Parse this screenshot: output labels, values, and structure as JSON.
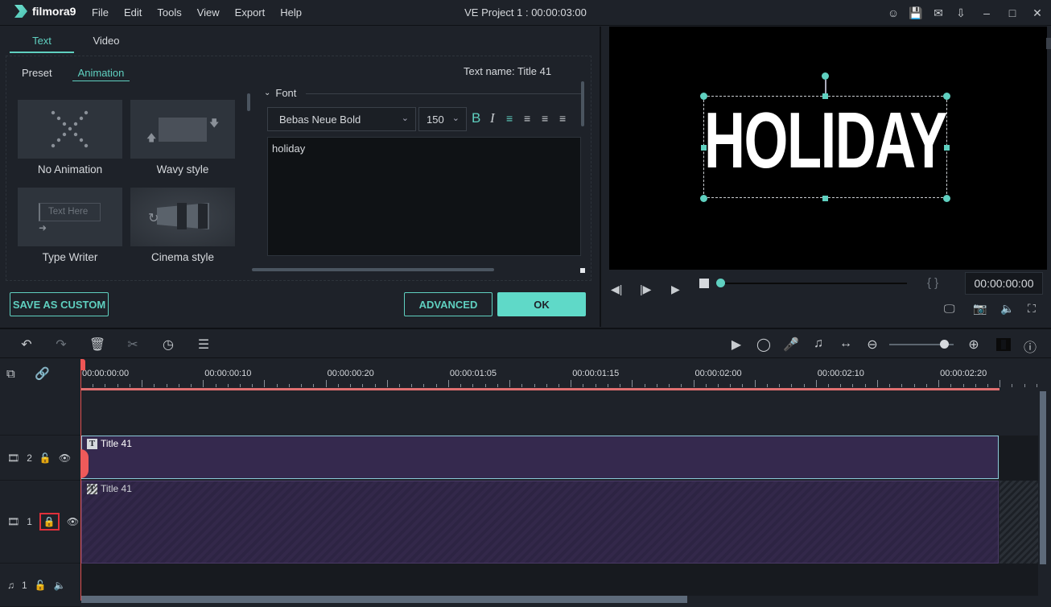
{
  "app": {
    "logo_text": "filmora9",
    "menu": [
      "File",
      "Edit",
      "Tools",
      "View",
      "Export",
      "Help"
    ],
    "project_title": "VE Project 1 : 00:00:03:00",
    "window_icons": [
      "account-icon",
      "save-icon",
      "mail-icon",
      "download-icon",
      "minimize-icon",
      "maximize-icon",
      "close-icon"
    ]
  },
  "editor": {
    "top_tabs": [
      {
        "label": "Text",
        "active": true
      },
      {
        "label": "Video",
        "active": false
      }
    ],
    "sub_tabs": [
      {
        "label": "Preset",
        "active": false
      },
      {
        "label": "Animation",
        "active": true
      }
    ],
    "animations": [
      {
        "label": "No Animation"
      },
      {
        "label": "Wavy style"
      },
      {
        "label": "Type Writer",
        "thumb_text": "Text Here"
      },
      {
        "label": "Cinema style"
      }
    ],
    "text_name": "Text name: Title 41",
    "font_section": "Font",
    "font_family": "Bebas Neue Bold",
    "font_size": "150",
    "text_value": "holiday",
    "buttons": {
      "save_custom": "SAVE AS CUSTOM",
      "advanced": "ADVANCED",
      "ok": "OK"
    }
  },
  "preview": {
    "display_text": "HOLIDAY",
    "timecode": "00:00:00:00",
    "progress": 0,
    "brace_marks": "{  }"
  },
  "timeline": {
    "ruler_labels": [
      "00:00:00:00",
      "00:00:00:10",
      "00:00:00:20",
      "00:00:01:05",
      "00:00:01:15",
      "00:00:02:00",
      "00:00:02:10",
      "00:00:02:20"
    ],
    "zoom_level": 0.85,
    "tracks": [
      {
        "type": "video",
        "number": "2",
        "locked": false,
        "clip": "Title 41"
      },
      {
        "type": "video",
        "number": "1",
        "locked": true,
        "clip": "Title 41"
      },
      {
        "type": "audio",
        "number": "1",
        "locked": false
      }
    ]
  },
  "colors": {
    "accent": "#5fd0c0",
    "clip": "#35294e",
    "playhead": "#e05050"
  }
}
